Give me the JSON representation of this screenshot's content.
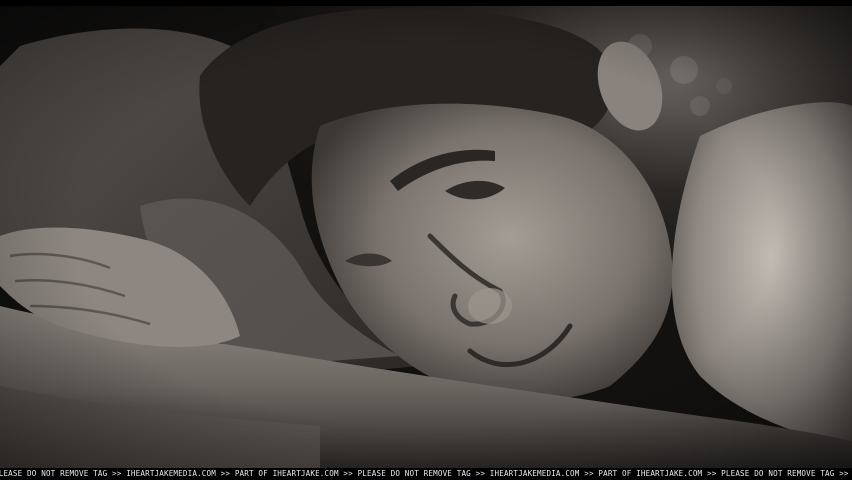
{
  "image": {
    "description_colors": {
      "shadow": "#0b0b0b",
      "skin_highlight": "#b9b2ab",
      "skin_mid": "#8a837d",
      "pillow": "#4a4542",
      "background_dark": "#1a1817"
    }
  },
  "watermark": {
    "text": "PLEASE DO NOT REMOVE TAG >> IHEARTJAKEMEDIA.COM >> PART OF IHEARTJAKE.COM >> PLEASE DO NOT REMOVE TAG >> IHEARTJAKEMEDIA.COM >> PART OF IHEARTJAKE.COM >> PLEASE DO NOT REMOVE TAG >> IHEARTJAKEMEDIA.COM >> PART OF IHEARTJAKEN"
  }
}
